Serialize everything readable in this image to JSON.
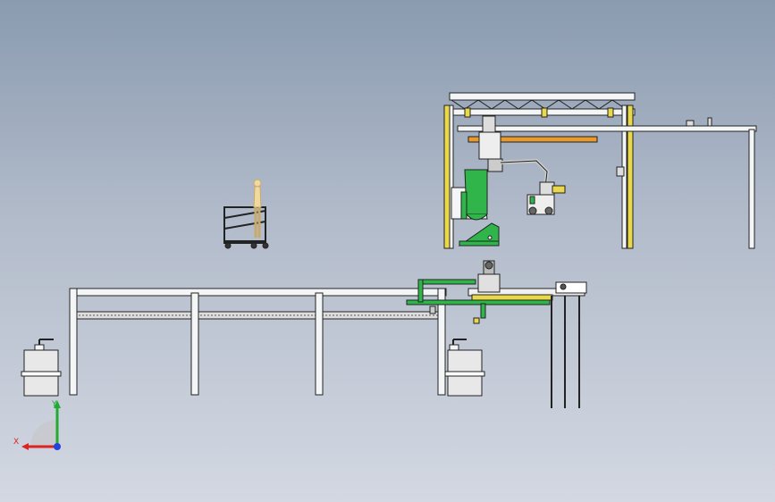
{
  "viewport": {
    "background_top": "#8a9bb0",
    "background_bottom": "#d3d8e2"
  },
  "colors": {
    "frame_white": "#f4f5f7",
    "outline": "#222222",
    "yellow_column": "#e8d84a",
    "green_part": "#2fb54a",
    "orange_beam": "#e89a2a",
    "axis_x": "#dd2222",
    "axis_y": "#22aa33",
    "axis_z": "#2244dd"
  },
  "triad": {
    "x_label": "X",
    "y_label": "Y"
  }
}
